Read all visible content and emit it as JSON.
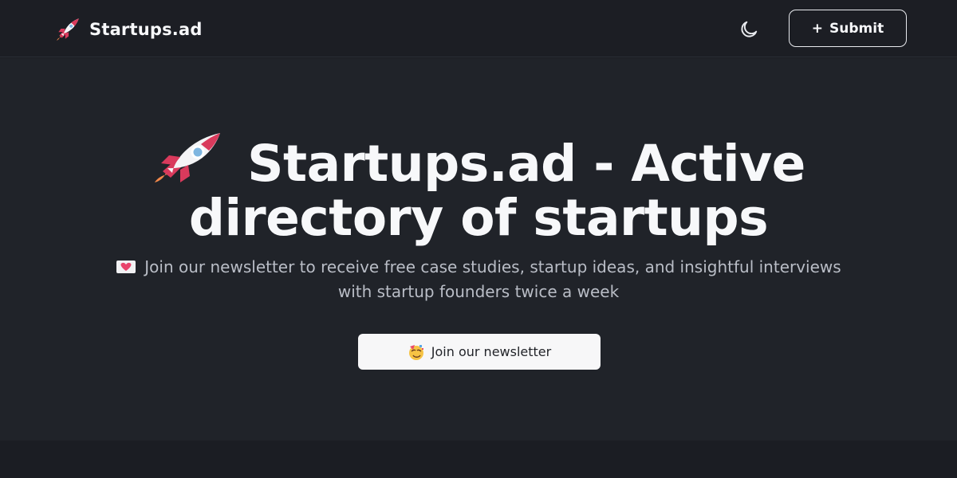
{
  "nav": {
    "brand_name": "Startups.ad",
    "theme_icon": "moon-icon",
    "submit_label": "Submit",
    "submit_icon": "plus"
  },
  "hero": {
    "title": "Startups.ad - Active directory of startups",
    "subtitle": "Join our newsletter to receive free case studies, startup ideas, and insightful interviews with startup founders twice a week",
    "cta_label": "Join our newsletter"
  },
  "icons": {
    "logo": "rocket-icon",
    "subtitle": "love-letter-icon",
    "cta": "party-icon"
  },
  "colors": {
    "background": "#1b1d23",
    "hero_background": "#202329",
    "text": "#f7f8fa",
    "muted_text": "#b9bdc6",
    "button_background": "#f7f7f8"
  }
}
